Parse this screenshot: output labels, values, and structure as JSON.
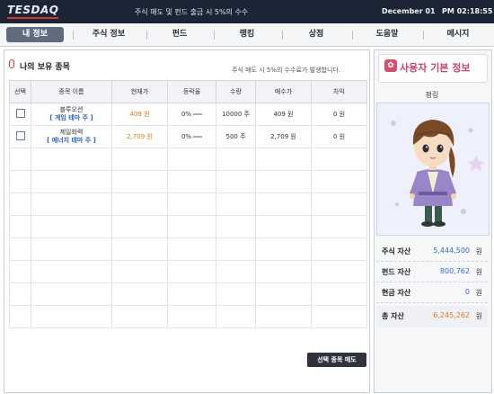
{
  "header": {
    "logo": "TESDAQ",
    "notice": "주식 매도 및 펀드 출금 시 5%의 수수",
    "date": "December 01",
    "time": "PM 02:18:55"
  },
  "nav": {
    "tabs": [
      {
        "label": "내 정보",
        "active": true
      },
      {
        "label": "주식 정보"
      },
      {
        "label": "펀드"
      },
      {
        "label": "랭킹"
      },
      {
        "label": "상점"
      },
      {
        "label": "도움말"
      },
      {
        "label": "메시지"
      }
    ]
  },
  "holdings": {
    "title": "나의 보유 종목",
    "fee_notice": "주식 매도 시 5%의 수수료가 발생합니다.",
    "columns": [
      "선택",
      "종목 이름",
      "현재가",
      "등락율",
      "수량",
      "매수가",
      "차익"
    ],
    "rows": [
      {
        "name": "블루오션",
        "theme": "[ 게임 테마 주 ]",
        "price": "409 원",
        "change": "0%",
        "qty": "10000 주",
        "buy": "409 원",
        "profit": "0 원"
      },
      {
        "name": "제일화력",
        "theme": "[ 에너지 테마 주 ]",
        "price": "2,709 원",
        "change": "0%",
        "qty": "500 주",
        "buy": "2,709 원",
        "profit": "0 원"
      }
    ],
    "sell_button": "선택 종목 매도"
  },
  "profile": {
    "title": "사용자 기본 정보",
    "nickname": "평링",
    "assets": [
      {
        "label": "주식 자산",
        "value": "5,444,500",
        "unit": "원"
      },
      {
        "label": "펀드 자산",
        "value": "800,762",
        "unit": "원"
      },
      {
        "label": "현금 자산",
        "value": "0",
        "unit": "원"
      }
    ],
    "total": {
      "label": "총 자산",
      "value": "6,245,262",
      "unit": "원"
    }
  }
}
